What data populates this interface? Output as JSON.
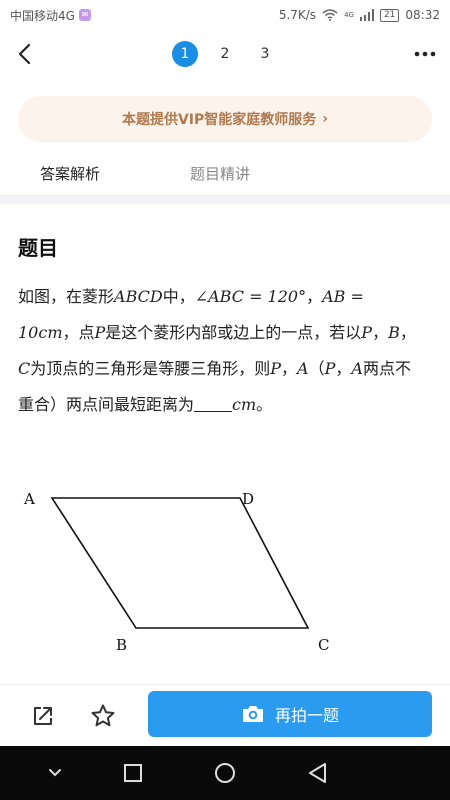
{
  "status_bar": {
    "carrier": "中国移动4G",
    "net_speed": "5.7K/s",
    "signal_badge": "4G",
    "battery": "21",
    "time": "08:32"
  },
  "nav": {
    "pages": [
      "1",
      "2",
      "3"
    ],
    "active_page": "1"
  },
  "banner": {
    "text": "本题提供VIP智能家庭教师服务",
    "arrow": "›"
  },
  "tabs": [
    {
      "label": "答案解析",
      "active": true
    },
    {
      "label": "题目精讲",
      "active": false
    }
  ],
  "question": {
    "heading": "题目",
    "t1": "如图，在菱形",
    "m1": "ABCD",
    "t2": "中，",
    "m2": "∠ABC = 120°",
    "t3": "，",
    "m3": "AB = 10cm",
    "t4": "，点",
    "m4": "P",
    "t5": "是这个菱形内部或边上的一点，若以",
    "m5": "P",
    "t6": "，",
    "m6": "B",
    "t7": "，",
    "m7": "C",
    "t8": "为顶点的三角形是等腰三角形，则",
    "m8": "P",
    "t9": "，",
    "m9": "A",
    "t10": "（",
    "m10": "P",
    "t11": "，",
    "m11": "A",
    "t12": "两点不重合）两点间最短距离为",
    "m12": "cm",
    "t13": "。"
  },
  "figure": {
    "labels": {
      "A": "A",
      "B": "B",
      "C": "C",
      "D": "D"
    }
  },
  "bottom": {
    "retake_label": "再拍一题"
  },
  "colors": {
    "accent": "#2b9bf0",
    "page_active": "#1a8de5",
    "banner_bg": "#fbf3ec",
    "banner_text": "#b07a4f"
  }
}
